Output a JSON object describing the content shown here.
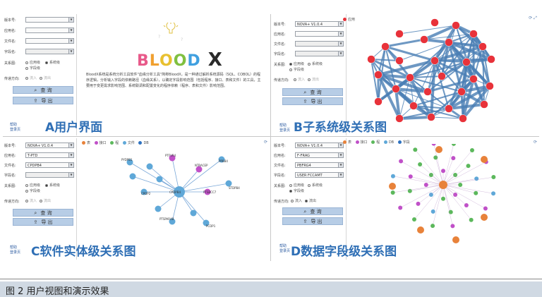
{
  "figure_caption": "图 2  用户视图和演示效果",
  "panels": {
    "a": {
      "caption": "A用户界面",
      "form": {
        "rows": [
          {
            "label": "版本号:",
            "value": ""
          },
          {
            "label": "应用名:",
            "value": ""
          },
          {
            "label": "文件名:",
            "value": ""
          },
          {
            "label": "字段名:",
            "value": ""
          }
        ],
        "relation_label": "关系图:",
        "radios": [
          "应用级",
          "系统级",
          "字段级"
        ],
        "direction_label": "传递方向:",
        "direction_radios": [
          "流入",
          "流出"
        ],
        "query_label": "查 询",
        "export_label": "导 出"
      },
      "footer_links": [
        "帮助",
        "登录页"
      ],
      "logo": "BLOOD X",
      "description": "BloodX系统是系统分析工具软件\"血缘分析工具\"简称BloodX，是一种通过解析系统源码（SQL、COBOL）的程序逻辑，分析输入字段的依赖路径（血缘关系），以确定字段影响范围（包括程序、接口、表和文件）的工具，主要用于变更需求影响范围、系统联调和配置变化的程序依赖（程序、表和文件）影响范围。"
    },
    "b": {
      "caption": "B子系统级关系图",
      "form": {
        "rows": [
          {
            "label": "版本号:",
            "value": "NOVA+ V1.0.4"
          },
          {
            "label": "应用名:",
            "value": ""
          },
          {
            "label": "文件名:",
            "value": ""
          },
          {
            "label": "字段名:",
            "value": ""
          }
        ],
        "relation_label": "关系图:",
        "radios": [
          "应用级",
          "系统级",
          "字段级"
        ],
        "direction_label": "传递方向:",
        "direction_radios": [
          "流入",
          "流出"
        ],
        "query_label": "查 询",
        "export_label": "导 出"
      },
      "footer_links": [
        "帮助",
        "登录页"
      ],
      "legend": [
        {
          "label": "应用",
          "color": "#e8323a"
        }
      ]
    },
    "c": {
      "caption": "C软件实体级关系图",
      "form": {
        "rows": [
          {
            "label": "版本号:",
            "value": "NOVA+ V1.0.4"
          },
          {
            "label": "应用名:",
            "value": "T-PTD"
          },
          {
            "label": "文件名:",
            "value": "CPDPB4"
          },
          {
            "label": "字段名:",
            "value": ""
          }
        ],
        "relation_label": "关系图:",
        "radios": [
          "应用级",
          "系统级",
          "字段级"
        ],
        "direction_label": "传递方向:",
        "direction_radios": [
          "流入",
          "流出"
        ],
        "query_label": "查 询",
        "export_label": "导 出"
      },
      "footer_links": [
        "帮助",
        "登录页"
      ],
      "legend": [
        {
          "label": "表",
          "color": "#e8823a"
        },
        {
          "label": "接口",
          "color": "#c050c8"
        },
        {
          "label": "程",
          "color": "#5cb85c"
        },
        {
          "label": "文件",
          "color": "#5fa8d8"
        },
        {
          "label": "DB",
          "color": "#2e72c0"
        }
      ],
      "nodes": [
        "CPDPB4",
        "PTFVR4",
        "NTRACEP",
        "PTSBCC7",
        "PTSPAR4B",
        "PYDPB1",
        "PCDP1",
        "CPDP2",
        "PPBB4",
        "STDPB4"
      ]
    },
    "d": {
      "caption": "D数据字段级关系图",
      "form": {
        "rows": [
          {
            "label": "版本号:",
            "value": "NOVA+ V1.0.4"
          },
          {
            "label": "应用名:",
            "value": "F-FRAG"
          },
          {
            "label": "文件名:",
            "value": "PBFRG4"
          },
          {
            "label": "字段名:",
            "value": "USER FCCAMT"
          }
        ],
        "relation_label": "关系图:",
        "radios": [
          "应用级",
          "系统级",
          "字段级"
        ],
        "direction_label": "传递方向:",
        "direction_radios": [
          "流入",
          "流出"
        ],
        "query_label": "查 询",
        "export_label": "导 出"
      },
      "footer_links": [
        "帮助",
        "登录页"
      ],
      "legend": [
        {
          "label": "表",
          "color": "#e8823a"
        },
        {
          "label": "接口",
          "color": "#c050c8"
        },
        {
          "label": "程",
          "color": "#5cb85c"
        },
        {
          "label": "DB",
          "color": "#5fa8d8"
        },
        {
          "label": "字段",
          "color": "#2e72c0"
        }
      ]
    }
  }
}
